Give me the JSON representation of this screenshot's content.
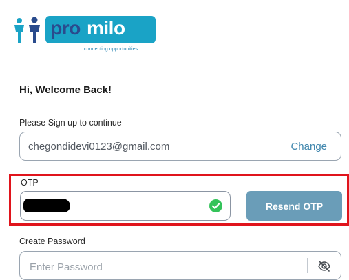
{
  "brand": {
    "name_part1": "pro",
    "name_part2": "milo",
    "tagline": "connecting opportunities",
    "color_primary": "#1aa3c6",
    "color_dark": "#2a4b8d"
  },
  "heading": "Hi, Welcome Back!",
  "signup_label": "Please Sign up to continue",
  "email": {
    "value": "chegondidevi0123@gmail.com",
    "change_label": "Change"
  },
  "otp": {
    "label": "OTP",
    "status_icon": "check-circle-icon",
    "resend_label": "Resend OTP"
  },
  "password": {
    "label": "Create Password",
    "placeholder": "Enter Password",
    "toggle_icon": "eye-slash-icon"
  },
  "colors": {
    "accent": "#3f86ad",
    "button": "#6a9db8",
    "success": "#34c35a",
    "highlight": "#e0141c"
  }
}
